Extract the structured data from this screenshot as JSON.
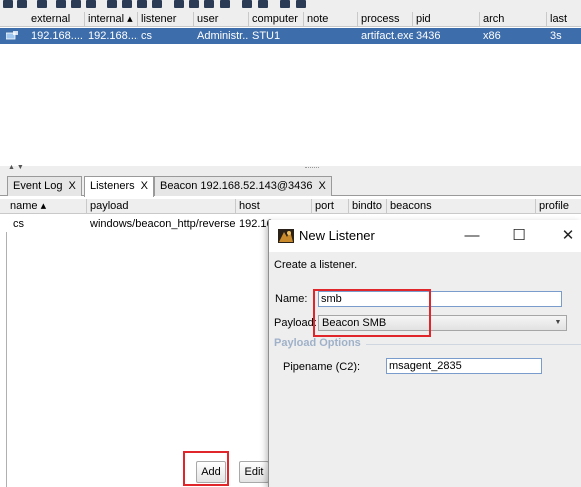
{
  "toolbar": {
    "icons": [
      "connect-icon",
      "disconnect-icon",
      "headphones-icon",
      "listeners-icon",
      "sessions-icon",
      "pivot-graph-icon",
      "targets-icon",
      "download-icon",
      "keystrokes-icon",
      "screenshots-icon",
      "settings-icon",
      "coffee-icon",
      "notes-icon",
      "script-icon",
      "link-icon",
      "cloud-icon",
      "log-icon",
      "cube-icon"
    ]
  },
  "beacons": {
    "columns": [
      "external",
      "internal ▴",
      "listener",
      "user",
      "computer",
      "note",
      "process",
      "pid",
      "arch",
      "last"
    ],
    "row": {
      "external": "192.168....",
      "internal": "192.168....",
      "listener": "cs",
      "user": "Administr...",
      "computer": "STU1",
      "note": "",
      "process": "artifact.exe",
      "pid": "3436",
      "arch": "x86",
      "last": "3s"
    }
  },
  "tabs": [
    {
      "label": "Event Log",
      "close": "X"
    },
    {
      "label": "Listeners",
      "close": "X"
    },
    {
      "label": "Beacon 192.168.52.143@3436",
      "close": "X"
    }
  ],
  "listeners": {
    "columns": [
      "name ▴",
      "payload",
      "host",
      "port",
      "bindto",
      "beacons",
      "profile"
    ],
    "row": {
      "name": "cs",
      "payload": "windows/beacon_http/reverse...",
      "host": "192.16"
    }
  },
  "buttons": {
    "add": "Add",
    "edit": "Edit"
  },
  "dialog": {
    "title": "New Listener",
    "minimize": "—",
    "maximize": "☐",
    "close": "✕",
    "description": "Create a listener.",
    "name_label": "Name:",
    "name_value": "smb",
    "payload_label": "Payload:",
    "payload_value": "Beacon SMB",
    "section_title": "Payload Options",
    "pipename_label": "Pipename (C2):",
    "pipename_value": "msagent_2835"
  },
  "colors": {
    "selection": "#3d6dab",
    "highlight_box": "#e0262b",
    "section_title": "#9fb1c9"
  }
}
